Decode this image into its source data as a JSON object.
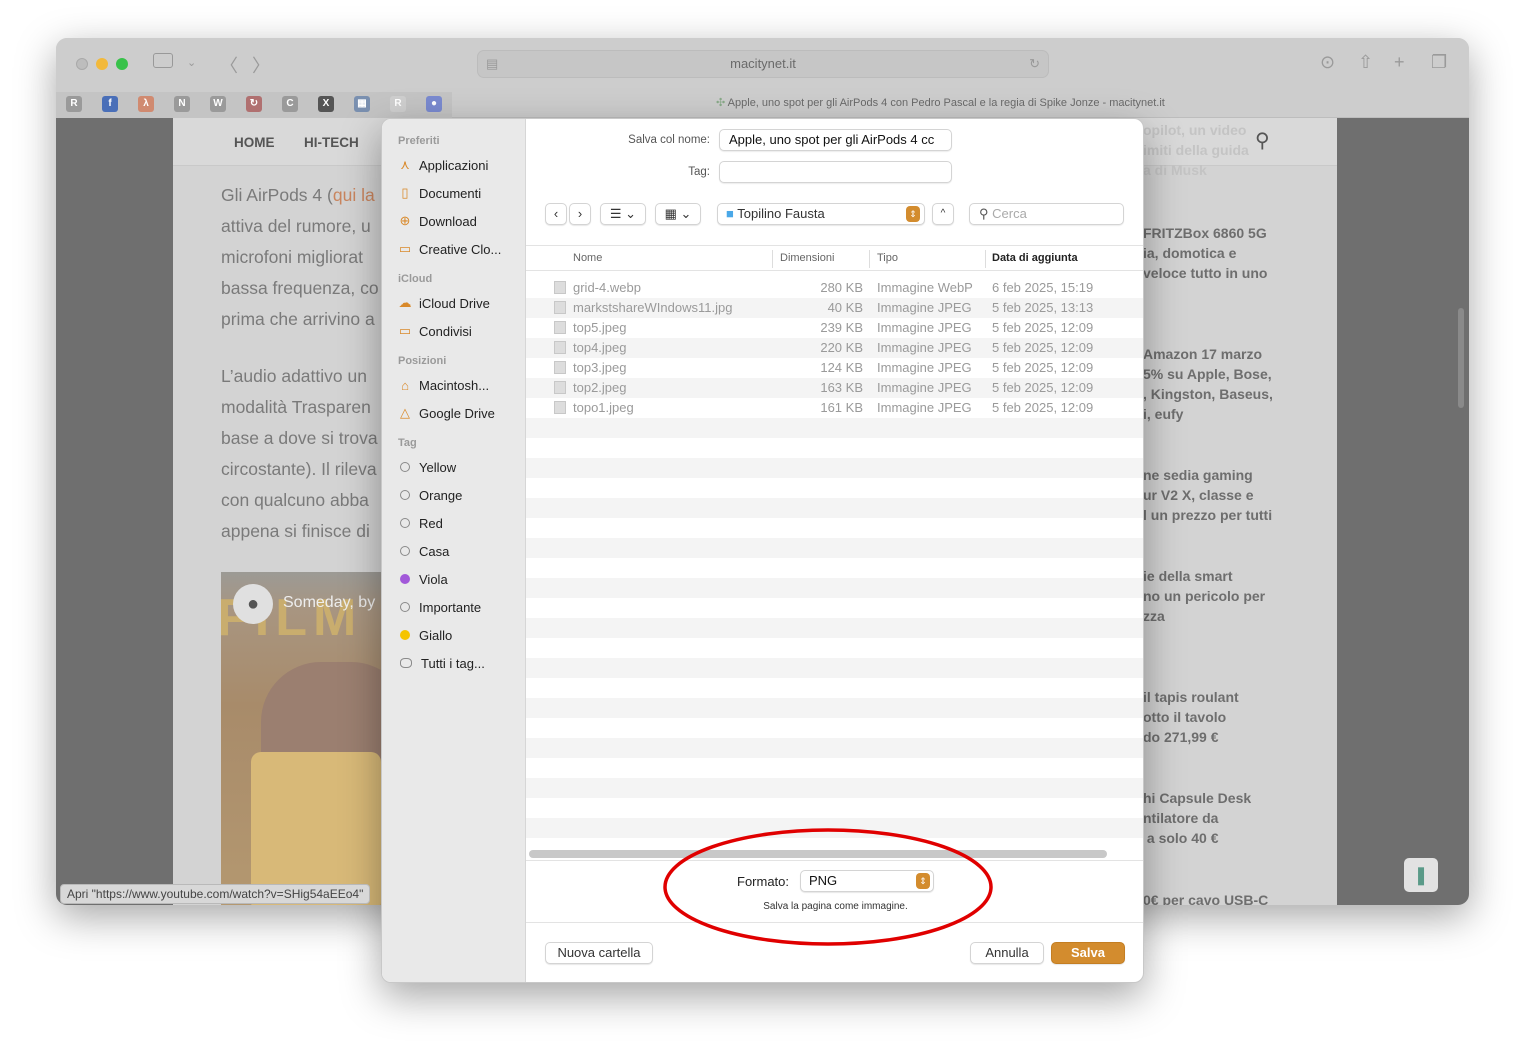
{
  "browser": {
    "url": "macitynet.it",
    "tab_title": "Apple, uno spot per gli AirPods 4 con Pedro Pascal e la regia di Spike Jonze - macitynet.it",
    "favorites": [
      {
        "letter": "R",
        "color": "#9a9a9a"
      },
      {
        "letter": "f",
        "color": "#4a6fb8"
      },
      {
        "letter": "λ",
        "color": "#d08a70"
      },
      {
        "letter": "N",
        "color": "#9a9a9a"
      },
      {
        "letter": "W",
        "color": "#9a9a9a"
      },
      {
        "letter": "↻",
        "color": "#b07070"
      },
      {
        "letter": "C",
        "color": "#9a9a9a"
      },
      {
        "letter": "X",
        "color": "#555555"
      },
      {
        "letter": "▦",
        "color": "#7a90b0"
      },
      {
        "letter": "R",
        "color": "#cfcfcf"
      },
      {
        "letter": "●",
        "color": "#7a8ad0"
      }
    ],
    "status_text": "Apri \"https://www.youtube.com/watch?v=SHig54aEEo4\""
  },
  "page": {
    "nav": [
      "HOME",
      "HI-TECH"
    ],
    "paragraph1": [
      "Gli AirPods 4 (qui la",
      "attiva del rumore, u",
      "microfoni migliorat",
      "bassa frequenza, co",
      "prima che arrivino a"
    ],
    "paragraph2": [
      "L’audio adattivo un",
      "modalità Trasparen",
      "base a dove si trova",
      "circostante). Il rileva",
      "con qualcuno abba",
      "appena si finisce di"
    ],
    "video_title": "Someday, by",
    "video_bg_text": "FILM",
    "sidebar_snippets": [
      "opilot, un video\nimiti della guida\na di Musk",
      "FRITZBox 6860 5G\nia, domotica e\nveloce tutto in uno",
      "Amazon 17 marzo\n5% su Apple, Bose,\n, Kingston, Baseus,\ni, eufy",
      "ne sedia gaming\nur V2 X, classe e\nl un prezzo per tutti",
      "ie della smart\nno un pericolo per\nzza",
      "il tapis roulant\notto il tavolo\ndo 271,99 €",
      "hi Capsule Desk\nntilatore da\n a solo 40 €",
      "0€ per cavo USB-C"
    ]
  },
  "dialog": {
    "sidebar": {
      "sections": [
        {
          "title": "Preferiti",
          "items": [
            {
              "label": "Applicazioni",
              "icon": "apps-icon",
              "glyph": "⋏"
            },
            {
              "label": "Documenti",
              "icon": "document-icon",
              "glyph": "▯"
            },
            {
              "label": "Download",
              "icon": "download-icon",
              "glyph": "⊕"
            },
            {
              "label": "Creative Clo...",
              "icon": "folder-icon",
              "glyph": "▭"
            }
          ]
        },
        {
          "title": "iCloud",
          "items": [
            {
              "label": "iCloud Drive",
              "icon": "cloud-icon",
              "glyph": "☁"
            },
            {
              "label": "Condivisi",
              "icon": "shared-folder-icon",
              "glyph": "▭"
            }
          ]
        },
        {
          "title": "Posizioni",
          "items": [
            {
              "label": "Macintosh...",
              "icon": "disk-icon",
              "glyph": "⌂"
            },
            {
              "label": "Google Drive",
              "icon": "drive-icon",
              "glyph": "△"
            }
          ]
        },
        {
          "title": "Tag",
          "items": [
            {
              "label": "Yellow",
              "tag": ""
            },
            {
              "label": "Orange",
              "tag": ""
            },
            {
              "label": "Red",
              "tag": ""
            },
            {
              "label": "Casa",
              "tag": ""
            },
            {
              "label": "Viola",
              "tag": "#a259d9"
            },
            {
              "label": "Importante",
              "tag": ""
            },
            {
              "label": "Giallo",
              "tag": "#f5c400"
            },
            {
              "label": "Tutti i tag...",
              "tag": "all"
            }
          ]
        }
      ]
    },
    "save_as_label": "Salva col nome:",
    "save_as_value": "Apple, uno spot per gli AirPods 4 cc",
    "tag_label": "Tag:",
    "tag_value": "",
    "location": "Topilino Fausta",
    "search_placeholder": "Cerca",
    "columns": [
      "Nome",
      "Dimensioni",
      "Tipo",
      "Data di aggiunta"
    ],
    "files": [
      {
        "name": "grid-4.webp",
        "size": "280 KB",
        "type": "Immagine WebP",
        "date": "6 feb 2025, 15:19"
      },
      {
        "name": "markstshareWIndows11.jpg",
        "size": "40 KB",
        "type": "Immagine JPEG",
        "date": "5 feb 2025, 13:13"
      },
      {
        "name": "top5.jpeg",
        "size": "239 KB",
        "type": "Immagine JPEG",
        "date": "5 feb 2025, 12:09"
      },
      {
        "name": "top4.jpeg",
        "size": "220 KB",
        "type": "Immagine JPEG",
        "date": "5 feb 2025, 12:09"
      },
      {
        "name": "top3.jpeg",
        "size": "124 KB",
        "type": "Immagine JPEG",
        "date": "5 feb 2025, 12:09"
      },
      {
        "name": "top2.jpeg",
        "size": "163 KB",
        "type": "Immagine JPEG",
        "date": "5 feb 2025, 12:09"
      },
      {
        "name": "topo1.jpeg",
        "size": "161 KB",
        "type": "Immagine JPEG",
        "date": "5 feb 2025, 12:09"
      }
    ],
    "format_label": "Formato:",
    "format_value": "PNG",
    "format_hint": "Salva la pagina come immagine.",
    "new_folder": "Nuova cartella",
    "cancel": "Annulla",
    "save": "Salva",
    "accent": "#d38c2e",
    "annotation_color": "#e00000"
  }
}
